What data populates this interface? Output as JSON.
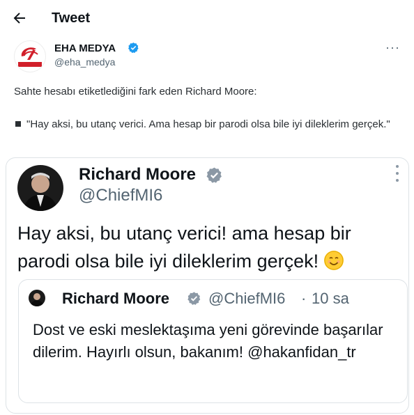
{
  "header": {
    "title": "Tweet"
  },
  "author": {
    "name": "EHA MEDYA",
    "handle": "@eha_medya",
    "logo_text": "EHA MEDYA"
  },
  "tweet": {
    "line1": "Sahte hesabı etiketlediğini fark eden Richard Moore:",
    "line2": "\"Hay aksi, bu utanç verici. Ama hesap bir parodi olsa bile iyi dileklerim gerçek.\""
  },
  "embedded": {
    "name": "Richard Moore",
    "handle": "@ChiefMI6",
    "text": "Hay aksi, bu utanç verici! ama hesap bir parodi olsa bile iyi dileklerim gerçek!",
    "quoted": {
      "name": "Richard Moore",
      "handle": "@ChiefMI6",
      "separator": "·",
      "time": "10 sa",
      "text": "Dost ve eski meslektaşıma yeni görevinde başarılar dilerim.  Hayırlı olsun, bakanım! @hakanfidan_tr"
    }
  },
  "colors": {
    "verified": "#1d9bf0",
    "logo_red": "#d11f2a",
    "secondary_text": "#536471"
  },
  "icons": [
    "back-arrow-icon",
    "verified-badge-icon",
    "more-options-icon",
    "smiling-face-emoji-icon"
  ]
}
